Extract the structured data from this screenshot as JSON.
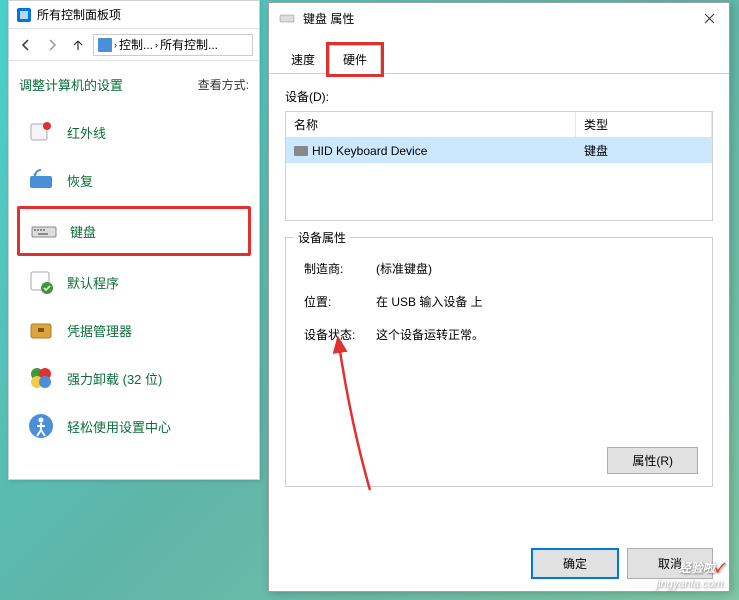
{
  "controlPanel": {
    "title": "所有控制面板项",
    "nav": {
      "path1": "控制...",
      "path2": "所有控制..."
    },
    "heading": "调整计算机的设置",
    "viewLabel": "查看方式:",
    "items": [
      {
        "label": "红外线",
        "icon": "infrared"
      },
      {
        "label": "恢复",
        "icon": "recovery"
      },
      {
        "label": "键盘",
        "icon": "keyboard",
        "highlighted": true
      },
      {
        "label": "默认程序",
        "icon": "defaults"
      },
      {
        "label": "凭据管理器",
        "icon": "credentials"
      },
      {
        "label": "强力卸载 (32 位)",
        "icon": "uninstall"
      },
      {
        "label": "轻松使用设置中心",
        "icon": "ease"
      }
    ]
  },
  "dialog": {
    "title": "键盘 属性",
    "tabs": [
      {
        "label": "速度",
        "active": false
      },
      {
        "label": "硬件",
        "active": true,
        "highlighted": true
      }
    ],
    "deviceGroup": {
      "label": "设备(D):",
      "columns": {
        "name": "名称",
        "type": "类型"
      },
      "rows": [
        {
          "name": "HID Keyboard Device",
          "type": "键盘"
        }
      ]
    },
    "propGroup": {
      "label": "设备属性",
      "manufacturerKey": "制造商:",
      "manufacturerVal": "(标准键盘)",
      "locationKey": "位置:",
      "locationVal": "在 USB 输入设备 上",
      "statusKey": "设备状态:",
      "statusVal": "这个设备运转正常。",
      "propBtn": "属性(R)"
    },
    "buttons": {
      "ok": "确定",
      "cancel": "取消"
    }
  },
  "watermark": {
    "main": "经验啦",
    "sub": "jingyanla.com"
  }
}
